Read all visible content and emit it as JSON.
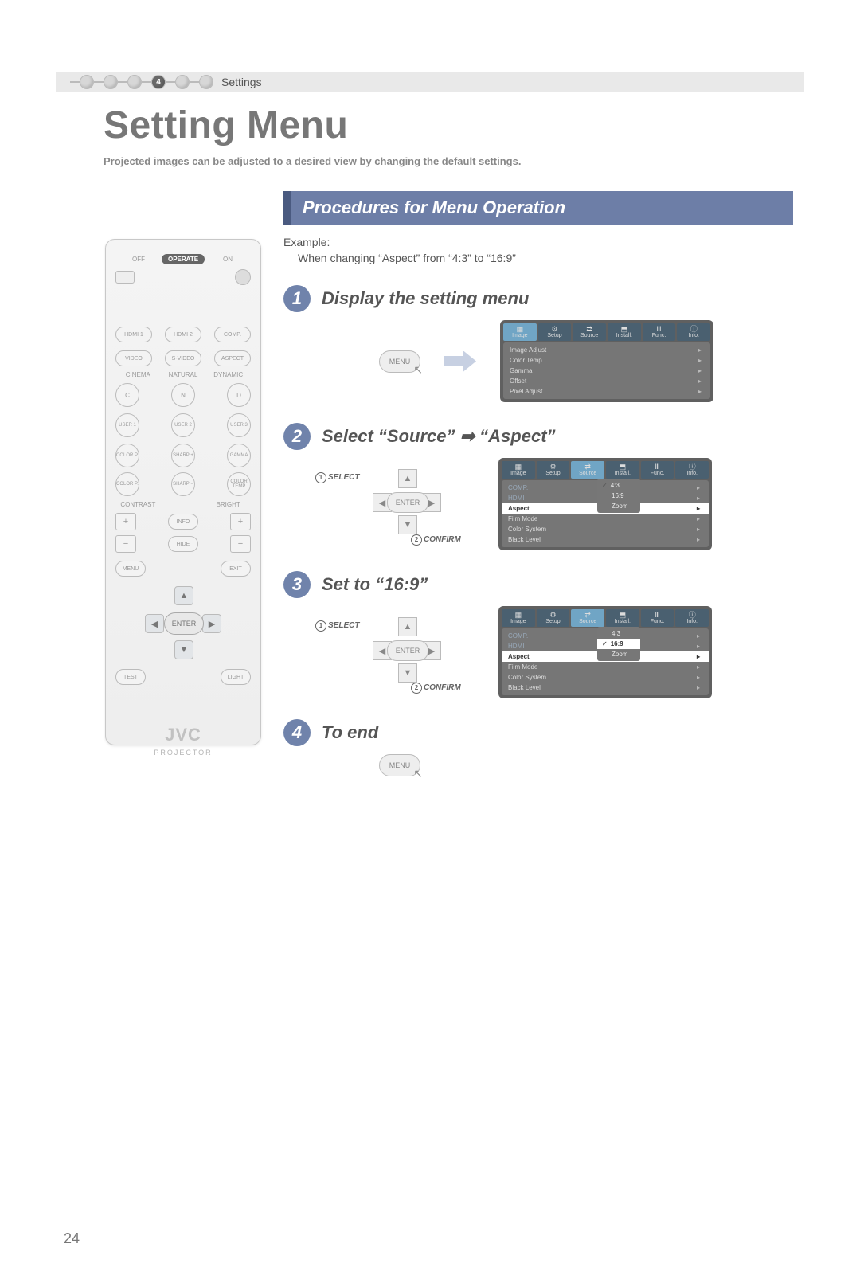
{
  "breadcrumb": {
    "active_index": "4",
    "label": "Settings"
  },
  "title": "Setting Menu",
  "subtitle": "Projected images can be adjusted to a desired view by changing the default settings.",
  "section_bar": "Procedures for Menu Operation",
  "example_label": "Example:",
  "example_text": "When changing “Aspect” from “4:3” to “16:9”",
  "steps": {
    "s1": {
      "num": "1",
      "title": "Display the setting menu"
    },
    "s2": {
      "num": "2",
      "title": "Select “Source” ➡ “Aspect”"
    },
    "s3": {
      "num": "3",
      "title": "Set to “16:9”"
    },
    "s4": {
      "num": "4",
      "title": "To end"
    }
  },
  "annot": {
    "select": "SELECT",
    "confirm": "CONFIRM",
    "n1": "1",
    "n2": "2"
  },
  "remote": {
    "off": "OFF",
    "operate": "OPERATE",
    "on": "ON",
    "row1": [
      "HDMI 1",
      "HDMI 2",
      "COMP."
    ],
    "row2": [
      "VIDEO",
      "S-VIDEO",
      "ASPECT"
    ],
    "row2b": [
      "CINEMA",
      "NATURAL",
      "DYNAMIC"
    ],
    "row2c": [
      "C",
      "N",
      "D"
    ],
    "row3": [
      "USER 1",
      "USER 2",
      "USER 3"
    ],
    "row4": [
      "COLOR P.",
      "SHARP +",
      "GAMMA"
    ],
    "row5": [
      "COLOR P.",
      "SHARP −",
      "COLOR TEMP"
    ],
    "contrast": "CONTRAST",
    "bright": "BRIGHT",
    "info": "INFO",
    "hide": "HIDE",
    "menu": "MENU",
    "exit": "EXIT",
    "enter": "ENTER",
    "test": "TEST",
    "light": "LIGHT",
    "brand": "JVC",
    "brand_sub": "PROJECTOR",
    "plus": "+",
    "minus": "−"
  },
  "btn": {
    "menu": "MENU",
    "enter": "ENTER"
  },
  "arrows": {
    "up": "▲",
    "down": "▼",
    "left": "◀",
    "right": "▶"
  },
  "osd": {
    "tabs": [
      "Image",
      "Setup",
      "Source",
      "Install.",
      "Func.",
      "Info."
    ],
    "image_rows": [
      "Image Adjust",
      "Color Temp.",
      "Gamma",
      "Offset",
      "Pixel Adjust"
    ],
    "source_rows": [
      "COMP.",
      "HDMI",
      "Aspect",
      "Film Mode",
      "Color System",
      "Black Level"
    ],
    "aspect_options": [
      "4:3",
      "16:9",
      "Zoom"
    ],
    "chev": "▸",
    "check": "✓"
  },
  "page_number": "24"
}
